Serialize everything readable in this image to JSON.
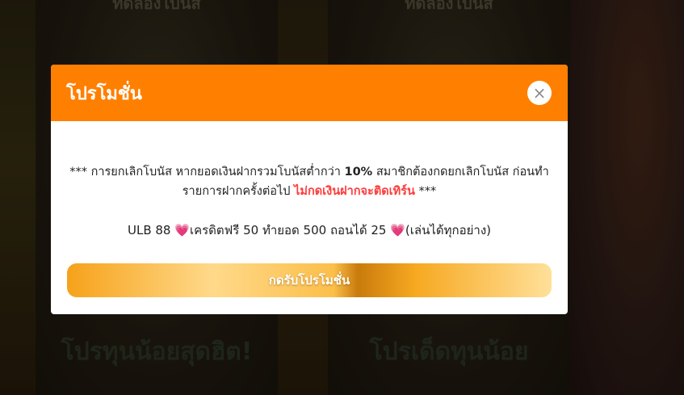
{
  "background": {
    "card_a_caption": "ทดลองโบนัส",
    "card_b_caption": "ทดลองโบนัส",
    "card_a_banner": "โปรทุนน้อยสุดฮิต!",
    "card_b_banner": "โปรเด็ดทุนน้อย"
  },
  "modal": {
    "title": "โปรโมชั่น",
    "close_icon": "×",
    "terms": {
      "prefix": "*** การยกเลิกโบนัส หากยอดเงินฝากรวมโบนัสต่ำกว่า ",
      "threshold": "10%",
      "middle": " สมาชิกต้องกดยกเลิกโบนัส ก่อนทำรายการฝากครั้งต่อไป ",
      "warning": "ไม่กดเงินฝากจะติดเทิร์น",
      "suffix": " ***"
    },
    "offer": {
      "code": "ULB 88",
      "details": "เครดิตฟรี 50 ทำยอด 500 ถอนได้ 25",
      "note": "(เล่นได้ทุกอย่าง)",
      "heart_icon": "💗"
    },
    "cta_label": "กดรับโปรโมชั่น"
  },
  "colors": {
    "header": "#ff7f00",
    "warning_text": "#ff3c3c",
    "cta_gold": "#f6a21a"
  }
}
